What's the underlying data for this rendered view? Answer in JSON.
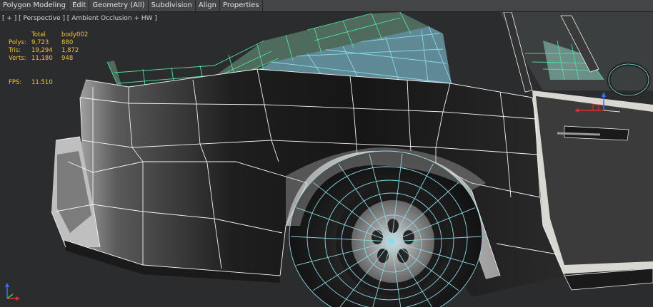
{
  "menubar": {
    "tabs": [
      "Polygon Modeling",
      "Edit",
      "Geometry (All)",
      "Subdivision",
      "Align",
      "Properties"
    ]
  },
  "viewport": {
    "label": "[ + ] [ Perspective ] [ Ambient Occlusion + HW ]"
  },
  "stats": {
    "header": [
      "",
      "Total",
      "body002"
    ],
    "rows": [
      {
        "label": "Polys:",
        "total": "9,723",
        "selected": "880"
      },
      {
        "label": "Tris:",
        "total": "19,294",
        "selected": "1,872"
      },
      {
        "label": "Verts:",
        "total": "11,180",
        "selected": "948"
      }
    ],
    "fps_label": "FPS:",
    "fps_value": "11.510"
  },
  "colors": {
    "wire_white": "#f4f4f4",
    "wire_cyan": "#8ad8e6",
    "wire_green": "#4fe39a",
    "stats_text": "#f0c23a"
  }
}
